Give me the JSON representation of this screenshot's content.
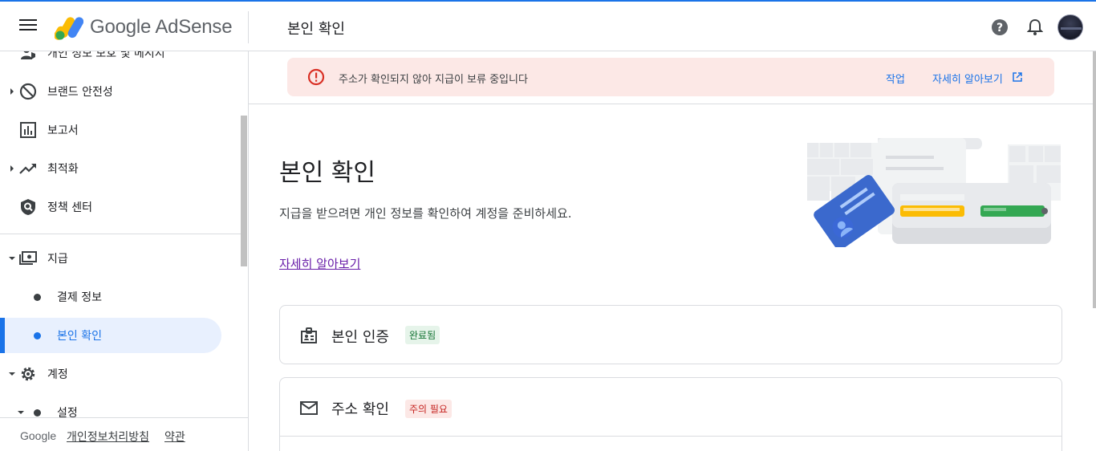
{
  "app": {
    "brand": "Google AdSense",
    "page_heading": "본인 확인"
  },
  "colors": {
    "accent": "#1a73e8",
    "alert_bg": "#fce8e6",
    "error": "#d93025",
    "success_bg": "#e6f4ea",
    "success_text": "#137333"
  },
  "sidebar": {
    "items": [
      {
        "label": "개인 정보 보호 및 메시지",
        "icon": "privacy-icon"
      },
      {
        "label": "브랜드 안전성",
        "icon": "block-icon"
      },
      {
        "label": "보고서",
        "icon": "bar-chart-icon"
      },
      {
        "label": "최적화",
        "icon": "trending-up-icon"
      },
      {
        "label": "정책 센터",
        "icon": "shield-icon"
      },
      {
        "label": "지급",
        "icon": "payments-icon"
      },
      {
        "label": "결제 정보"
      },
      {
        "label": "본인 확인",
        "active": true
      },
      {
        "label": "계정",
        "icon": "gear-icon"
      },
      {
        "label": "설정"
      }
    ],
    "footer": {
      "google": "Google",
      "privacy": "개인정보처리방침",
      "terms": "약관"
    }
  },
  "alert": {
    "text": "주소가 확인되지 않아 지급이 보류 중입니다",
    "action": "작업",
    "learn_more": "자세히 알아보기"
  },
  "main": {
    "title": "본인 확인",
    "description": "지급을 받으려면 개인 정보를 확인하여 계정을 준비하세요.",
    "learn_more": "자세히 알아보기"
  },
  "cards": [
    {
      "title": "본인 인증",
      "badge": "완료됨",
      "status": "ok"
    },
    {
      "title": "주소 확인",
      "badge": "주의 필요",
      "status": "warn"
    }
  ]
}
